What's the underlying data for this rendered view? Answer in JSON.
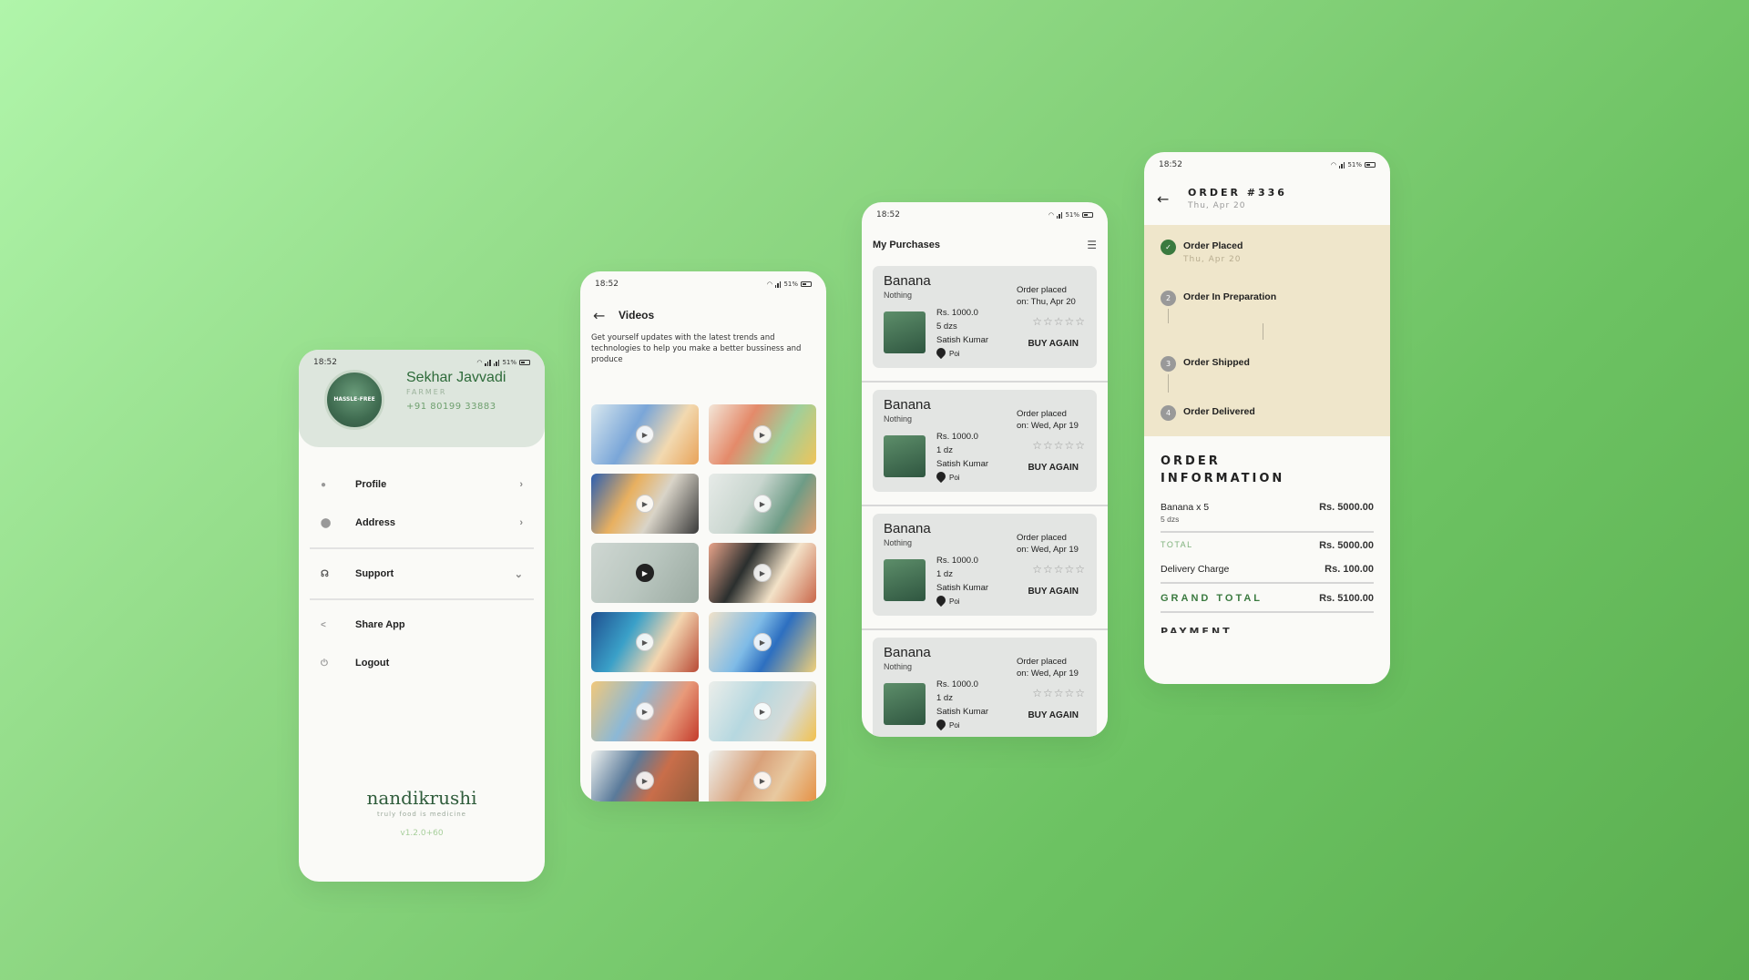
{
  "status": {
    "time": "18:52",
    "battery": "51%"
  },
  "profile_screen": {
    "name": "Sekhar Javvadi",
    "role": "FARMER",
    "phone": "+91 80199 33883",
    "avatar_text": "HASSLE-FREE",
    "menu": [
      {
        "label": "Profile",
        "icon": "person-icon",
        "chevron": "›"
      },
      {
        "label": "Address",
        "icon": "location-pin-icon",
        "chevron": "›"
      },
      {
        "label": "Support",
        "icon": "headset-icon",
        "chevron": "⌄"
      },
      {
        "label": "Share App",
        "icon": "share-icon"
      },
      {
        "label": "Logout",
        "icon": "power-icon"
      }
    ],
    "brand": "nandikrushi",
    "tagline": "truly food is medicine",
    "version": "v1.2.0+60"
  },
  "videos_screen": {
    "title": "Videos",
    "description": "Get yourself updates with the latest trends and technologies to help you make a better bussiness and produce",
    "thumbnail_count": 12
  },
  "purchases_screen": {
    "title": "My Purchases",
    "items": [
      {
        "name": "Banana",
        "sub": "Nothing",
        "price": "Rs. 1000.0",
        "qty": "5 dzs",
        "seller": "Satish Kumar",
        "location": "Poi",
        "order_line1": "Order placed",
        "order_line2": "on: Thu, Apr 20",
        "action": "BUY AGAIN"
      },
      {
        "name": "Banana",
        "sub": "Nothing",
        "price": "Rs. 1000.0",
        "qty": "1 dz",
        "seller": "Satish Kumar",
        "location": "Poi",
        "order_line1": "Order placed",
        "order_line2": "on: Wed, Apr 19",
        "action": "BUY AGAIN"
      },
      {
        "name": "Banana",
        "sub": "Nothing",
        "price": "Rs. 1000.0",
        "qty": "1 dz",
        "seller": "Satish Kumar",
        "location": "Poi",
        "order_line1": "Order placed",
        "order_line2": "on: Wed, Apr 19",
        "action": "BUY AGAIN"
      },
      {
        "name": "Banana",
        "sub": "Nothing",
        "price": "Rs. 1000.0",
        "qty": "1 dz",
        "seller": "Satish Kumar",
        "location": "Poi",
        "order_line1": "Order placed",
        "order_line2": "on: Wed, Apr 19",
        "action": "BUY AGAIN"
      }
    ]
  },
  "order_screen": {
    "title": "ORDER #336",
    "date": "Thu, Apr 20",
    "steps": [
      {
        "num": "✓",
        "label": "Order Placed",
        "sub": "Thu, Apr 20"
      },
      {
        "num": "2",
        "label": "Order In Preparation"
      },
      {
        "num": "3",
        "label": "Order Shipped"
      },
      {
        "num": "4",
        "label": "Order Delivered"
      }
    ],
    "info_title_1": "ORDER",
    "info_title_2": "INFORMATION",
    "item_name": "Banana x 5",
    "item_qty": "5 dzs",
    "item_amount": "Rs. 5000.00",
    "total_label": "TOTAL",
    "total_amount": "Rs. 5000.00",
    "delivery_label": "Delivery Charge",
    "delivery_amount": "Rs. 100.00",
    "grand_label": "GRAND TOTAL",
    "grand_amount": "Rs. 5100.00",
    "payment_label": "PAYMENT"
  },
  "colors": {
    "brand_green": "#3a7a3f",
    "timeline_bg": "#efe6cb",
    "card_bg": "#e3e5e3"
  }
}
